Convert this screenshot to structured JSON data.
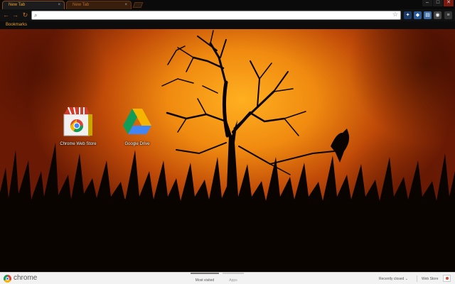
{
  "tabs": [
    {
      "label": "New Tab",
      "active": true
    },
    {
      "label": "New Tab",
      "active": false
    }
  ],
  "window_controls": {
    "minimize": "–",
    "maximize": "□",
    "close": "✕"
  },
  "toolbar": {
    "back": "←",
    "forward": "→",
    "reload": "↻",
    "omnibox_value": "",
    "extensions": [
      "lightbulb-extension-icon",
      "shield-extension-icon",
      "notes-extension-icon",
      "sync-extension-icon",
      "settings-icon"
    ]
  },
  "bookmarks_bar": {
    "label": "Bookmarks"
  },
  "apps": [
    {
      "name": "Chrome Web Store",
      "icon": "chrome-web-store-icon"
    },
    {
      "name": "Google Drive",
      "icon": "google-drive-icon"
    }
  ],
  "footer": {
    "brand": "chrome",
    "most_visited": "Most visited",
    "apps": "Apps",
    "recently_closed": "Recently closed",
    "web_store": "Web Store"
  },
  "theme_colors": {
    "accent": "#f0a030",
    "sky_center": "#ffb020",
    "sky_edge": "#6a1a04"
  }
}
